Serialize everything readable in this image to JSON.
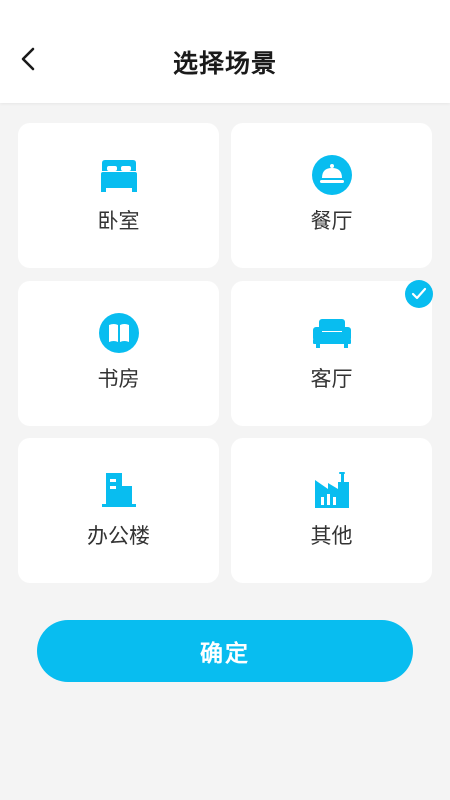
{
  "header": {
    "title": "选择场景",
    "back_icon": "chevron-left-icon"
  },
  "scenes": [
    {
      "label": "卧室",
      "icon": "bed-icon",
      "selected": false
    },
    {
      "label": "餐厅",
      "icon": "cloche-icon",
      "selected": false
    },
    {
      "label": "书房",
      "icon": "book-icon",
      "selected": false
    },
    {
      "label": "客厅",
      "icon": "sofa-icon",
      "selected": true
    },
    {
      "label": "办公楼",
      "icon": "office-building-icon",
      "selected": false
    },
    {
      "label": "其他",
      "icon": "factory-icon",
      "selected": false
    }
  ],
  "confirm_label": "确定",
  "colors": {
    "accent": "#08bdf0",
    "background": "#f4f4f4",
    "card": "#ffffff",
    "text": "#333333"
  }
}
